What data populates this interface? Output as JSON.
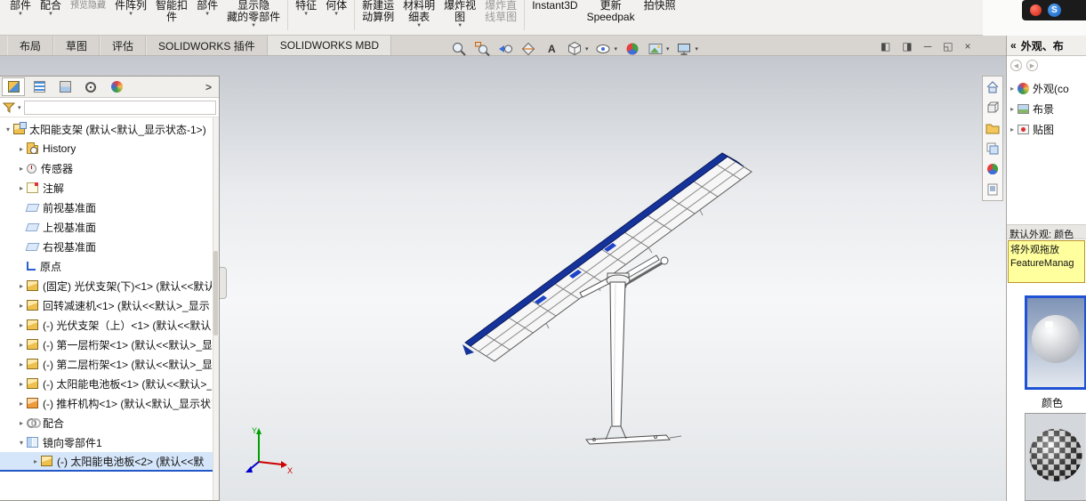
{
  "ribbon": {
    "items": [
      {
        "lines": [
          "部件"
        ],
        "arrow": "▼"
      },
      {
        "lines": [
          "配合"
        ],
        "arrow": "▼"
      },
      {
        "lines": [
          "预览隐藏"
        ]
      },
      {
        "lines": [
          "件阵列"
        ],
        "arrow": "▼"
      },
      {
        "lines": [
          "智能扣",
          "件"
        ]
      },
      {
        "lines": [
          "部件"
        ],
        "arrow": "▼"
      },
      {
        "lines": [
          "显示隐",
          "藏的零部件"
        ],
        "arrow": "▼"
      },
      {
        "lines": [
          "特征"
        ],
        "arrow": "▼"
      },
      {
        "lines": [
          "何体"
        ],
        "arrow": "▼"
      },
      {
        "lines": [
          "新建运",
          "动算例"
        ]
      },
      {
        "lines": [
          "材料明",
          "细表"
        ],
        "arrow": "▼"
      },
      {
        "lines": [
          "爆炸视",
          "图"
        ],
        "arrow": "▼"
      },
      {
        "lines": [
          "爆炸直",
          "线草图"
        ]
      },
      {
        "lines": [
          "Instant3D"
        ]
      },
      {
        "lines": [
          "更新",
          "Speedpak"
        ]
      },
      {
        "lines": [
          "拍快照"
        ]
      }
    ]
  },
  "tabs": {
    "items": [
      "布局",
      "草图",
      "评估",
      "SOLIDWORKS 插件",
      "SOLIDWORKS MBD"
    ]
  },
  "view_toolbar": {
    "icons": [
      {
        "name": "zoom-fit"
      },
      {
        "name": "zoom-area"
      },
      {
        "name": "previous-view"
      },
      {
        "name": "section-view"
      },
      {
        "name": "dynamic-annotation",
        "glyph": "A"
      },
      {
        "name": "display-style",
        "arrow": "▾"
      },
      {
        "name": "hide-show-items",
        "arrow": "▾"
      },
      {
        "name": "edit-appearance"
      },
      {
        "name": "apply-scene",
        "arrow": "▾"
      },
      {
        "name": "view-settings",
        "arrow": "▾"
      }
    ]
  },
  "window_controls": {
    "pane_left": "◧",
    "pane_right": "◨",
    "minimize": "─",
    "restore": "◱",
    "close": "×"
  },
  "feature_tree": {
    "chevron": ">",
    "filter_value": "",
    "root": {
      "label": "太阳能支架 (默认<默认_显示状态-1>)",
      "arrow": "▾"
    },
    "items": [
      {
        "label": "History",
        "arrow": "▸"
      },
      {
        "label": "传感器",
        "arrow": "▸"
      },
      {
        "label": "注解",
        "arrow": "▸"
      },
      {
        "label": "前视基准面"
      },
      {
        "label": "上视基准面"
      },
      {
        "label": "右视基准面"
      },
      {
        "label": "原点"
      },
      {
        "label": "(固定) 光伏支架(下)<1> (默认<<默认",
        "arrow": "▸"
      },
      {
        "label": "回转减速机<1> (默认<<默认>_显示",
        "arrow": "▸"
      },
      {
        "label": "(-) 光伏支架（上）<1> (默认<<默认",
        "arrow": "▸"
      },
      {
        "label": "(-) 第一层桁架<1> (默认<<默认>_显",
        "arrow": "▸"
      },
      {
        "label": "(-) 第二层桁架<1> (默认<<默认>_显",
        "arrow": "▸"
      },
      {
        "label": "(-) 太阳能电池板<1> (默认<<默认>_",
        "arrow": "▸"
      },
      {
        "label": "(-) 推杆机构<1> (默认<默认_显示状态",
        "arrow": "▸"
      },
      {
        "label": "配合",
        "arrow": "▸"
      },
      {
        "label": "镜向零部件1",
        "arrow": "▾"
      },
      {
        "label": "(-) 太阳能电池板<2> (默认<<默",
        "arrow": "▸"
      }
    ]
  },
  "task_pane": {
    "collapse": "«",
    "header": "外观、布",
    "nav_back": "◀",
    "nav_fwd": "▶",
    "tree": [
      {
        "label": "外观(co",
        "arrow": "▸"
      },
      {
        "label": "布景",
        "arrow": "▸"
      },
      {
        "label": "贴图",
        "arrow": "▸"
      }
    ],
    "section_label": "默认外观: 颜色",
    "tooltip_line1": "将外观拖放",
    "tooltip_line2": "FeatureManag",
    "swatch_label": "颜色"
  },
  "side_toolbar": {
    "icons": [
      "home",
      "view-cube",
      "file-explorer",
      "view-palette",
      "appearances",
      "document"
    ]
  },
  "viewport": {
    "triad": {
      "x_label": "X",
      "y_label": "Y"
    }
  },
  "tray": {
    "sogou_letter": "S"
  }
}
